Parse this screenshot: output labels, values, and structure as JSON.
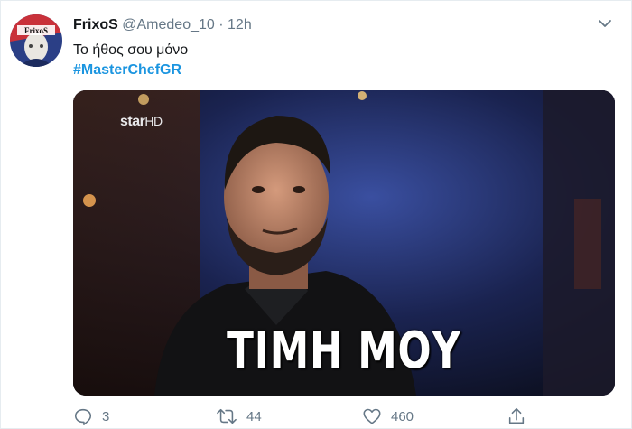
{
  "tweet": {
    "author_name": "FrixoS",
    "handle": "@Amedeo_10",
    "separator": "·",
    "time": "12h",
    "text": "Το ήθος σου μόνο",
    "hashtag": "#MasterChefGR",
    "avatar_label": "FrixoS"
  },
  "media": {
    "channel_logo_main": "star",
    "channel_logo_suffix": "HD",
    "caption": "ΤΙΜΗ ΜΟΥ"
  },
  "actions": {
    "reply_count": "3",
    "retweet_count": "44",
    "like_count": "460"
  },
  "icons": {
    "reply": "reply-icon",
    "retweet": "retweet-icon",
    "like": "heart-icon",
    "share": "share-icon",
    "more": "chevron-down-icon"
  },
  "colors": {
    "hashtag": "#1b95e0",
    "secondary_text": "#657786"
  }
}
